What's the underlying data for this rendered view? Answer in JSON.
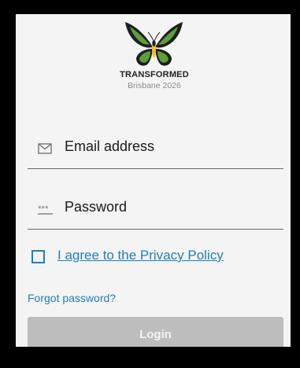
{
  "brand": {
    "name": "TRANSFORMED",
    "subtitle": "Brisbane 2026",
    "logo_icon": "butterfly-icon"
  },
  "email": {
    "placeholder": "Email address",
    "icon": "mail-icon"
  },
  "password": {
    "placeholder": "Password",
    "icon": "password-dots-icon"
  },
  "privacy": {
    "label": "I agree to the Privacy Policy",
    "checked": false
  },
  "forgot_password": "Forgot password?",
  "login": {
    "label": "Login",
    "enabled": false
  },
  "colors": {
    "accent": "#1f7fb8",
    "background": "#f4f4f4",
    "button_disabled": "#bdbdbd"
  }
}
